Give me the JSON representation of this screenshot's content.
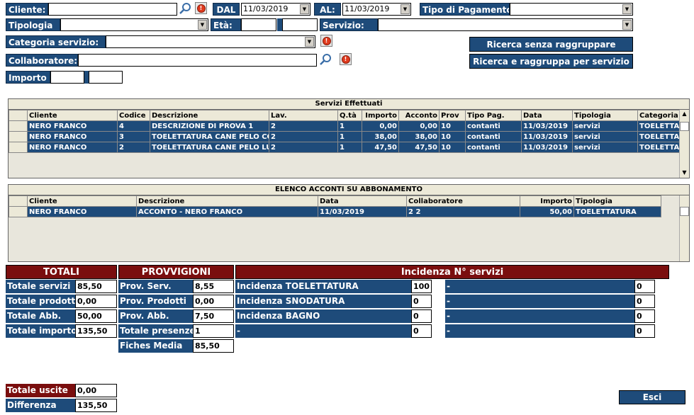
{
  "filters": {
    "cliente_label": "Cliente:",
    "dal_label": "DAL",
    "dal_value": "11/03/2019",
    "al_label": "AL:",
    "al_value": "11/03/2019",
    "tipo_pagamento_label": "Tipo di Pagamento:",
    "tipologia_label": "Tipologia",
    "eta_label": "Età:",
    "servizio_label": "Servizio:",
    "categoria_label": "Categoria servizio:",
    "collaboratore_label": "Collaboratore:",
    "importo_label": "Importo"
  },
  "buttons": {
    "ricerca_senza": "Ricerca senza raggruppare",
    "ricerca_raggruppa": "Ricerca e raggruppa per servizio",
    "esci": "Esci"
  },
  "servizi": {
    "title": "Servizi Effettuati",
    "columns": [
      "Cliente",
      "Codice",
      "Descrizione",
      "Lav.",
      "Q.tà",
      "Importo",
      "Acconto",
      "Prov",
      "Tipo Pag.",
      "Data",
      "Tipologia",
      "Categoria"
    ],
    "rows": [
      [
        "NERO FRANCO",
        "4",
        "DESCRIZIONE DI PROVA 1",
        "2",
        "1",
        "0,00",
        "0,00",
        "10",
        "contanti",
        "11/03/2019",
        "servizi",
        "TOELETTA"
      ],
      [
        "NERO FRANCO",
        "3",
        "TOELETTATURA CANE PELO CO",
        "2",
        "1",
        "38,00",
        "38,00",
        "10",
        "contanti",
        "11/03/2019",
        "servizi",
        "TOELETTA"
      ],
      [
        "NERO FRANCO",
        "2",
        "TOELETTATURA CANE PELO LU",
        "2",
        "1",
        "47,50",
        "47,50",
        "10",
        "contanti",
        "11/03/2019",
        "servizi",
        "TOELETTA"
      ]
    ]
  },
  "acconti": {
    "title": "ELENCO ACCONTI SU ABBONAMENTO",
    "columns": [
      "Cliente",
      "Descrizione",
      "Data",
      "Collaboratore",
      "Importo",
      "Tipologia"
    ],
    "rows": [
      [
        "NERO FRANCO",
        "ACCONTO - NERO FRANCO",
        "11/03/2019",
        "2 2",
        "50,00",
        "TOELETTATURA"
      ]
    ]
  },
  "totali": {
    "header": "TOTALI",
    "items": [
      {
        "label": "Totale servizi",
        "value": "85,50"
      },
      {
        "label": "Totale prodotti",
        "value": "0,00"
      },
      {
        "label": "Totale Abb.",
        "value": "50,00"
      },
      {
        "label": "Totale importo",
        "value": "135,50"
      }
    ]
  },
  "provvigioni": {
    "header": "PROVVIGIONI",
    "items": [
      {
        "label": "Prov. Serv.",
        "value": "8,55"
      },
      {
        "label": "Prov. Prodotti",
        "value": "0,00"
      },
      {
        "label": "Prov. Abb.",
        "value": "7,50"
      },
      {
        "label": "Totale presenze",
        "value": "1"
      },
      {
        "label": "Fiches Media",
        "value": "85,50"
      }
    ]
  },
  "incidenza": {
    "header": "Incidenza N° servizi",
    "left": [
      {
        "label": "Incidenza TOELETTATURA",
        "value": "100"
      },
      {
        "label": "Incidenza SNODATURA",
        "value": "0"
      },
      {
        "label": "Incidenza BAGNO",
        "value": "0"
      },
      {
        "label": "-",
        "value": "0"
      }
    ],
    "right": [
      {
        "label": "-",
        "value": "0"
      },
      {
        "label": "-",
        "value": "0"
      },
      {
        "label": "-",
        "value": "0"
      },
      {
        "label": "-",
        "value": "0"
      }
    ]
  },
  "uscite": {
    "label": "Totale uscite",
    "value": "0,00"
  },
  "differenza": {
    "label": "Differenza",
    "value": "135,50"
  }
}
